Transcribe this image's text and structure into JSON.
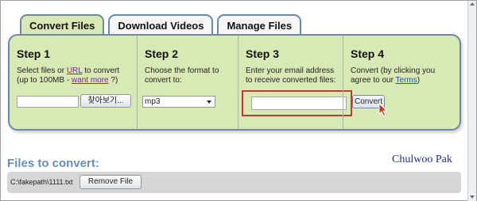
{
  "tabs": [
    {
      "label": "Convert Files",
      "active": true
    },
    {
      "label": "Download Videos",
      "active": false
    },
    {
      "label": "Manage Files",
      "active": false
    }
  ],
  "steps": {
    "step1": {
      "title": "Step 1",
      "desc_before_link": "Select files or ",
      "link_url": "URL",
      "desc_after_link": " to convert (up to 100MB - ",
      "link_more": "want more",
      "desc_end": " ?)",
      "browse_label": "찾아보기..."
    },
    "step2": {
      "title": "Step 2",
      "desc": "Choose the format to convert to:",
      "selected_format": "mp3"
    },
    "step3": {
      "title": "Step 3",
      "desc": "Enter your email address to receive converted files:",
      "email_value": ""
    },
    "step4": {
      "title": "Step 4",
      "desc_before_link": "Convert (by clicking you agree to our ",
      "link_terms": "Terms",
      "desc_end": ")",
      "convert_label": "Convert"
    }
  },
  "files": {
    "title": "Files to convert:",
    "author": "Chulwoo Pak",
    "items": [
      {
        "path": "C:\\fakepath\\1111.txt",
        "remove_label": "Remove File"
      }
    ]
  },
  "colors": {
    "panel_green": "#d9e9b5",
    "tab_border": "#6d87a8",
    "highlight_red": "#c0393a",
    "files_title_blue": "#6b8db5"
  }
}
